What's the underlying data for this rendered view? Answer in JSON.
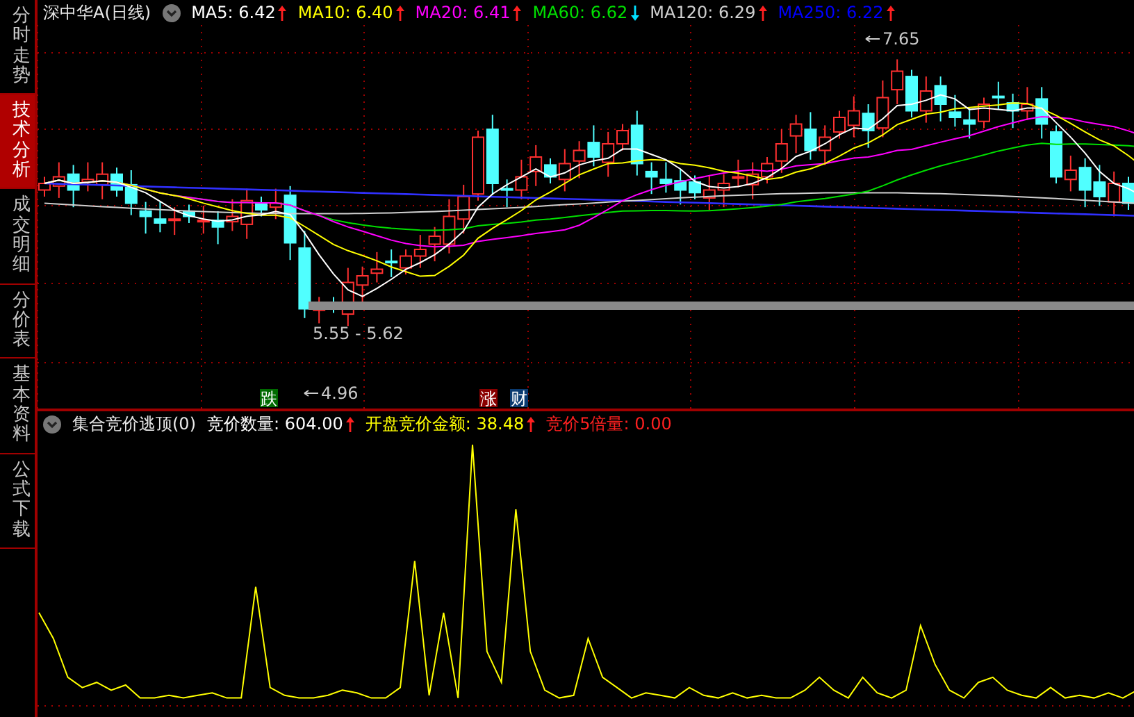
{
  "sidebar": {
    "tabs": [
      {
        "label": "分时走势",
        "selected": false
      },
      {
        "label": "技术分析",
        "selected": true
      },
      {
        "label": "成交明细",
        "selected": false
      },
      {
        "label": "分价表",
        "selected": false
      },
      {
        "label": "基本资料",
        "selected": false
      },
      {
        "label": "公式下载",
        "selected": false
      }
    ]
  },
  "header": {
    "title": "深中华A(日线)",
    "indicators": [
      {
        "label": "MA5:",
        "value": "6.42",
        "color": "#ffffff",
        "rising": true
      },
      {
        "label": "MA10:",
        "value": "6.40",
        "color": "#ffff00",
        "rising": true
      },
      {
        "label": "MA20:",
        "value": "6.41",
        "color": "#ff00ff",
        "rising": true
      },
      {
        "label": "MA60:",
        "value": "6.62",
        "color": "#00e000",
        "rising": false
      },
      {
        "label": "MA120:",
        "value": "6.29",
        "color": "#d0d0d0",
        "rising": true
      },
      {
        "label": "MA250:",
        "value": "6.22",
        "color": "#0000ff",
        "rising": true
      }
    ]
  },
  "price_chart": {
    "annotations": [
      {
        "kind": "high",
        "text": "7.65"
      },
      {
        "kind": "range",
        "text": "5.55 - 5.62"
      },
      {
        "kind": "low",
        "text": "4.96"
      }
    ],
    "badges": [
      {
        "text": "跌",
        "color": "#006a00"
      },
      {
        "text": "涨",
        "color": "#8a0000"
      },
      {
        "text": "财",
        "color": "#0a3a70"
      }
    ]
  },
  "indicator_panel": {
    "title": "集合竞价逃顶(0)",
    "fields": [
      {
        "label": "竞价数量:",
        "value": "604.00",
        "color": "#ffffff",
        "rising": true
      },
      {
        "label": "开盘竞价金额:",
        "value": "38.48",
        "color": "#ffff00",
        "rising": true
      },
      {
        "label": "竞价5倍量:",
        "value": "0.00",
        "color": "#ff2020"
      }
    ]
  }
}
